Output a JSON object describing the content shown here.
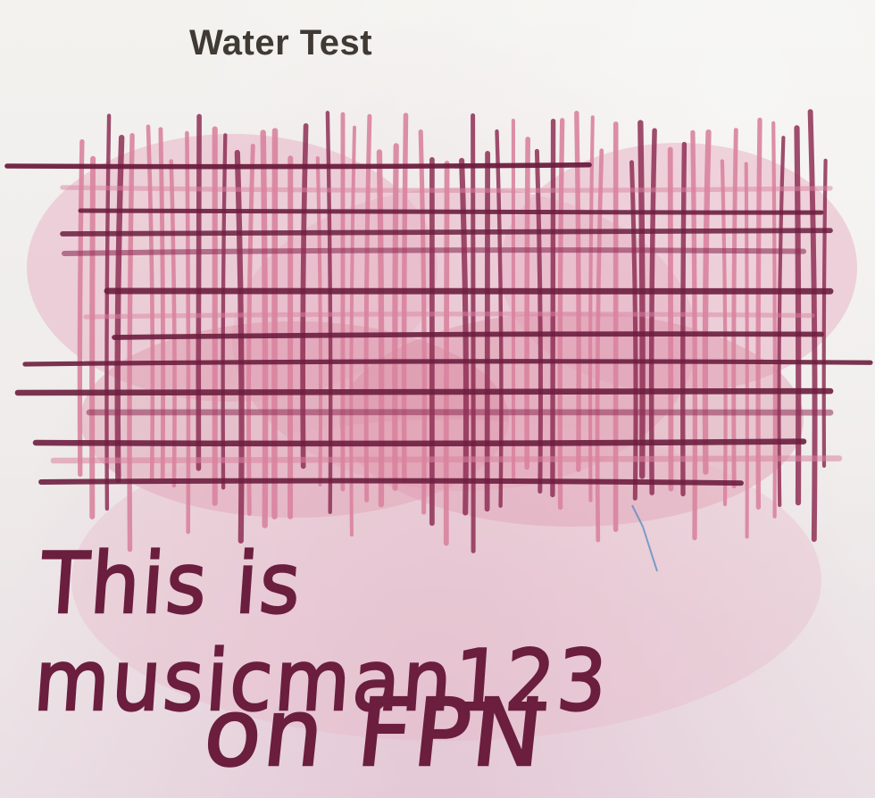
{
  "card": {
    "heading": "Water Test",
    "handwriting_line1": "This is musicman123",
    "handwriting_line2": "on FPN"
  },
  "colors": {
    "paper": "#efeceb",
    "heading_text": "#3f3a33",
    "ink_dark": "#6b1e3e",
    "ink_mid": "#8e2f55",
    "ink_wash": "#d9839f",
    "ink_wash_light": "#e8b4c6"
  }
}
